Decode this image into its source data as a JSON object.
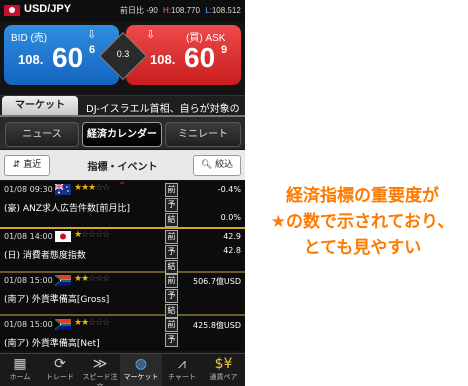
{
  "header": {
    "pair": "USD/JPY",
    "prev_change": "前日比 -90",
    "high_label": "H:",
    "high_value": "108.770",
    "low_label": "L:",
    "low_value": "108.512"
  },
  "bid": {
    "label": "BID (売)",
    "price_main": "108.",
    "price_big": "60",
    "price_small": "6"
  },
  "ask": {
    "label": "(買) ASK",
    "price_main": "108.",
    "price_big": "60",
    "price_small": "9"
  },
  "spread": "0.3",
  "ticker": {
    "tab": "マーケット",
    "headline": "DJ-イスラエル首相、自らが対象の"
  },
  "subtabs": [
    "ニュース",
    "経済カレンダー",
    "ミニレート"
  ],
  "active_subtab": 1,
  "filterbar": {
    "recent": "直近",
    "title": "指標・イベント",
    "filter": "絞込"
  },
  "labels": {
    "prev": "前",
    "forecast": "予",
    "result": "結"
  },
  "events": [
    {
      "date": "01/08 09:30",
      "country": "au",
      "stars": 3,
      "name": "(豪) ANZ求人広告件数[前月比]",
      "prev": "-0.4%",
      "forecast": "",
      "result": "0.0%"
    },
    {
      "date": "01/08 14:00",
      "country": "jp",
      "stars": 1,
      "name": "(日) 消費者態度指数",
      "prev": "42.9",
      "forecast": "42.8",
      "result": ""
    },
    {
      "date": "01/08 15:00",
      "country": "za",
      "stars": 2,
      "name": "(南ア) 外貨準備高[Gross]",
      "prev": "506.7億USD",
      "forecast": "",
      "result": ""
    },
    {
      "date": "01/08 15:00",
      "country": "za",
      "stars": 2,
      "name": "(南ア) 外貨準備高[Net]",
      "prev": "425.8億USD",
      "forecast": "",
      "result": ""
    }
  ],
  "nav": [
    {
      "label": "ホーム",
      "icon": "grid-icon"
    },
    {
      "label": "トレード",
      "icon": "refresh-icon"
    },
    {
      "label": "スピード注文",
      "icon": "speed-icon"
    },
    {
      "label": "マーケット",
      "icon": "globe-icon"
    },
    {
      "label": "チャート",
      "icon": "chart-icon"
    },
    {
      "label": "通貨ペア",
      "icon": "currency-icon"
    }
  ],
  "annotation": {
    "line1": "経済指標の重要度が",
    "line2": "★の数で示されており、",
    "line3": "とても見やすい"
  },
  "colors": {
    "bid": "#1a74d0",
    "ask": "#d82a2a",
    "annotation": "#ff7a00",
    "star": "#f0b400"
  }
}
